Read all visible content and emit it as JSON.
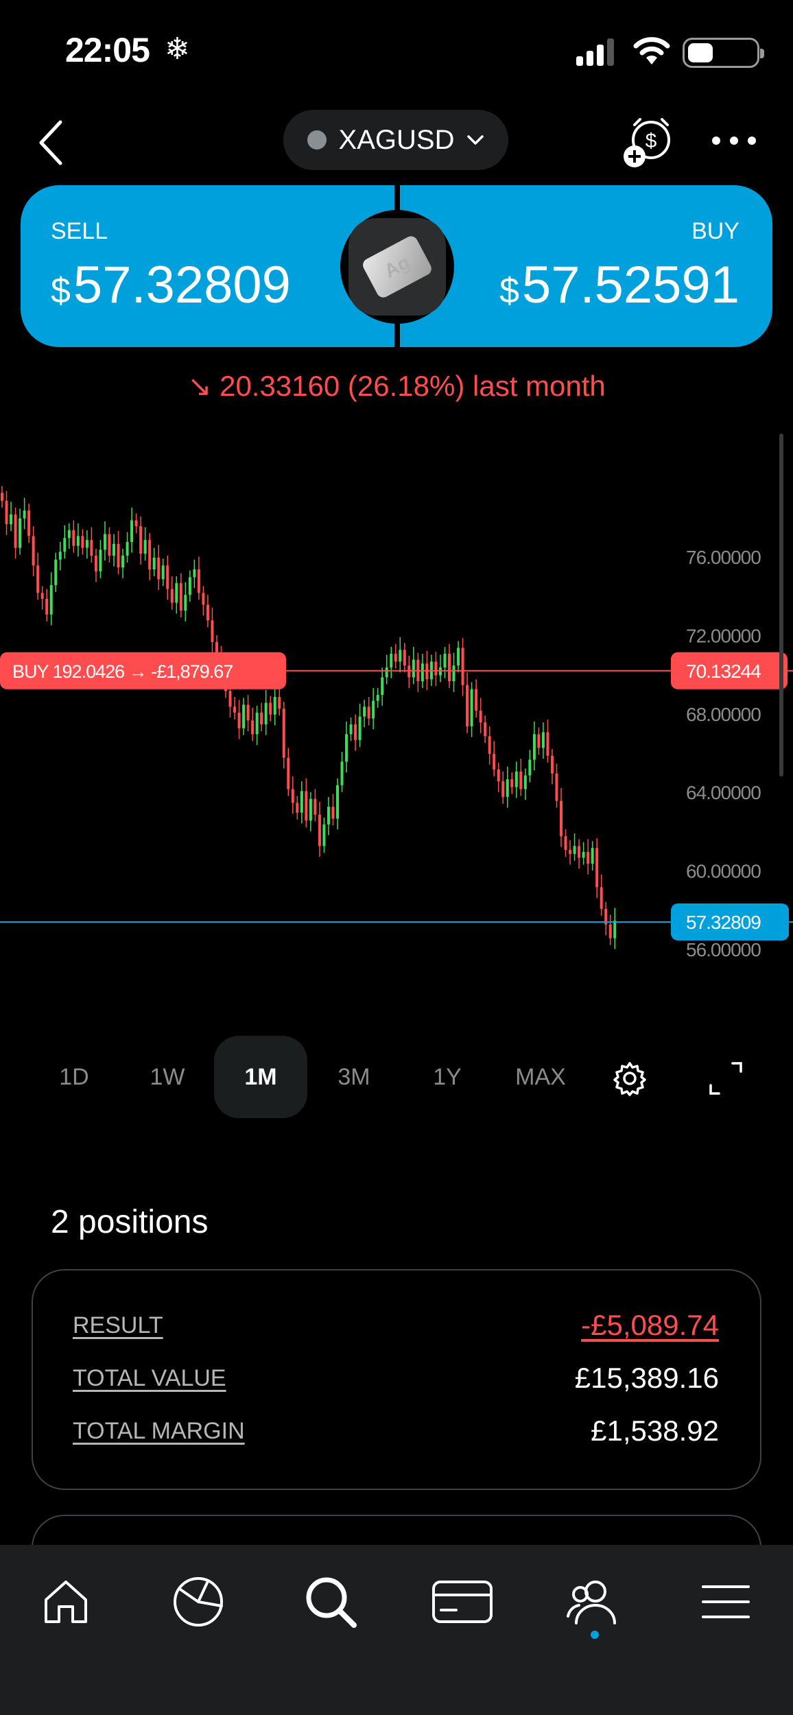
{
  "status_bar": {
    "time": "22:05",
    "extra": "❄"
  },
  "header": {
    "symbol": "XAGUSD"
  },
  "trade": {
    "sell_label": "SELL",
    "sell_currency": "$",
    "sell_price": "57.32809",
    "buy_label": "BUY",
    "buy_currency": "$",
    "buy_price": "57.52591",
    "badge_text": "Ag"
  },
  "change": {
    "text": "↘ 20.33160 (26.18%) last month"
  },
  "chart_data": {
    "type": "candlestick",
    "y_ticks": [
      "76.00000",
      "72.00000",
      "68.00000",
      "64.00000",
      "60.00000",
      "56.00000"
    ],
    "y_tick_values": [
      76,
      72,
      68,
      64,
      60,
      56
    ],
    "position_line": {
      "label": "BUY 192.0426  →  -£1,879.67",
      "price_label": "70.13244",
      "price": 70.13244
    },
    "current_line": {
      "price_label": "57.32809",
      "price": 57.32809
    },
    "closes": [
      78.8,
      77.6,
      78.1,
      76.4,
      77.9,
      78.3,
      77.0,
      75.5,
      74.1,
      73.8,
      73.0,
      74.5,
      75.8,
      76.2,
      76.9,
      77.3,
      76.5,
      77.0,
      76.4,
      76.8,
      76.0,
      75.2,
      76.3,
      77.1,
      76.0,
      76.6,
      75.4,
      76.0,
      76.7,
      77.8,
      77.5,
      76.1,
      76.8,
      75.3,
      75.9,
      74.8,
      75.5,
      74.3,
      73.6,
      74.6,
      73.2,
      74.0,
      74.9,
      75.3,
      74.1,
      73.5,
      72.7,
      71.6,
      70.9,
      69.8,
      69.1,
      68.3,
      68.0,
      67.2,
      68.4,
      67.6,
      66.9,
      68.0,
      67.4,
      68.5,
      67.9,
      68.8,
      68.2,
      65.7,
      64.1,
      63.4,
      62.9,
      64.0,
      62.5,
      63.6,
      62.8,
      61.2,
      62.3,
      63.2,
      62.6,
      64.3,
      65.5,
      66.9,
      67.4,
      66.6,
      67.8,
      68.3,
      67.7,
      68.6,
      68.9,
      69.8,
      70.3,
      71.0,
      70.6,
      71.2,
      70.4,
      69.8,
      70.7,
      69.6,
      70.5,
      69.7,
      70.6,
      69.9,
      70.3,
      71.0,
      69.6,
      70.4,
      71.3,
      69.4,
      67.3,
      69.2,
      68.1,
      67.5,
      66.8,
      65.9,
      65.1,
      64.5,
      63.7,
      64.6,
      64.2,
      65.0,
      64.1,
      64.8,
      65.6,
      66.9,
      66.2,
      67.0,
      65.8,
      64.9,
      63.5,
      61.7,
      61.0,
      60.8,
      61.2,
      60.6,
      60.9,
      60.3,
      61.1,
      59.1,
      58.0,
      57.2,
      56.5,
      57.4
    ]
  },
  "timeframes": [
    "1D",
    "1W",
    "1M",
    "3M",
    "1Y",
    "MAX"
  ],
  "timeframe_active": "1M",
  "positions": {
    "title": "2 positions",
    "rows": [
      {
        "label": "RESULT",
        "value": "-£5,089.74"
      },
      {
        "label": "TOTAL VALUE",
        "value": "£15,389.16"
      },
      {
        "label": "TOTAL MARGIN",
        "value": "£1,538.92"
      }
    ]
  },
  "colors": {
    "accent": "#00a0dc",
    "down": "#ff4d4f",
    "up": "#3ddc5a"
  }
}
